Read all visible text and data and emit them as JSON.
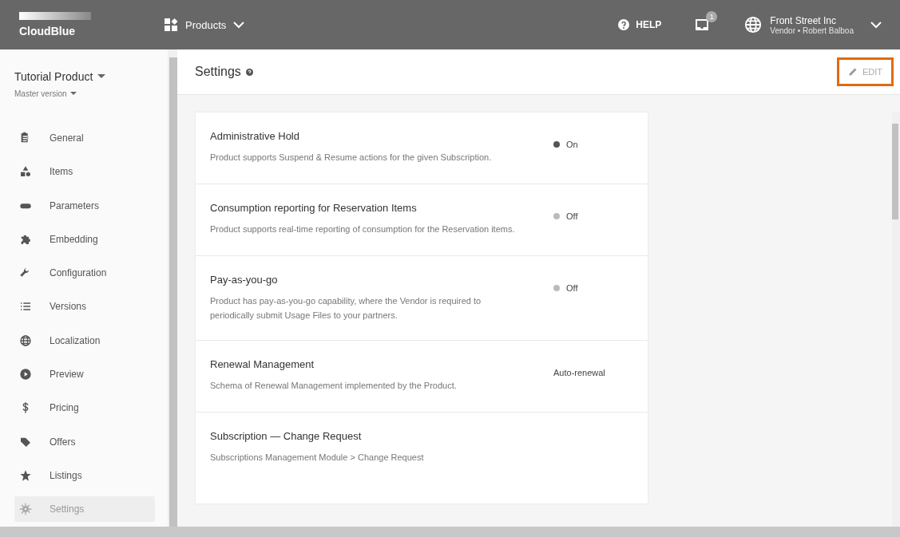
{
  "header": {
    "logo": "CloudBlue",
    "nav": "Products",
    "help": "HELP",
    "notifications": "1",
    "account": {
      "name": "Front Street Inc",
      "role": "Vendor • Robert Balboa"
    }
  },
  "sidebar": {
    "product": "Tutorial Product",
    "version": "Master version",
    "items": [
      {
        "label": "General",
        "selected": false
      },
      {
        "label": "Items",
        "selected": false
      },
      {
        "label": "Parameters",
        "selected": false
      },
      {
        "label": "Embedding",
        "selected": false
      },
      {
        "label": "Configuration",
        "selected": false
      },
      {
        "label": "Versions",
        "selected": false
      },
      {
        "label": "Localization",
        "selected": false
      },
      {
        "label": "Preview",
        "selected": false
      },
      {
        "label": "Pricing",
        "selected": false
      },
      {
        "label": "Offers",
        "selected": false
      },
      {
        "label": "Listings",
        "selected": false
      },
      {
        "label": "Settings",
        "selected": true
      }
    ]
  },
  "page": {
    "title": "Settings",
    "edit": "EDIT",
    "highlighted": true
  },
  "settings": [
    {
      "title": "Administrative Hold",
      "description": "Product supports Suspend & Resume actions for the given Subscription.",
      "kind": "toggle",
      "on": true,
      "value": "On"
    },
    {
      "title": "Consumption reporting for Reservation Items",
      "description": "Product supports real-time reporting of consumption for the Reservation items.",
      "kind": "toggle",
      "on": false,
      "value": "Off"
    },
    {
      "title": "Pay-as-you-go",
      "description": "Product has pay-as-you-go capability, where the Vendor is required to periodically submit Usage Files to your partners.",
      "kind": "toggle",
      "on": false,
      "value": "Off"
    },
    {
      "title": "Renewal Management",
      "description": "Schema of Renewal Management implemented by the Product.",
      "kind": "text",
      "value": "Auto-renewal"
    },
    {
      "title": "Subscription — Change Request",
      "description": "Subscriptions Management Module > Change Request",
      "kind": "none"
    }
  ]
}
